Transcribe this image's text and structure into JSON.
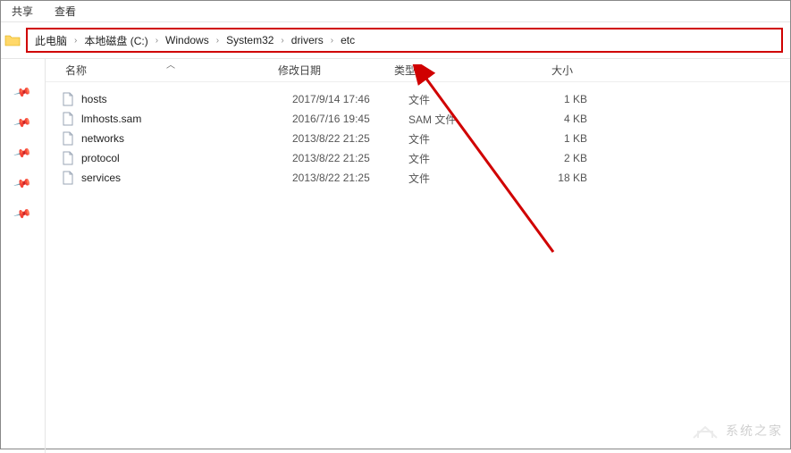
{
  "menubar": {
    "share": "共享",
    "view": "查看"
  },
  "breadcrumb": [
    "此电脑",
    "本地磁盘 (C:)",
    "Windows",
    "System32",
    "drivers",
    "etc"
  ],
  "columns": {
    "name": "名称",
    "date": "修改日期",
    "type": "类型",
    "size": "大小"
  },
  "files": [
    {
      "name": "hosts",
      "date": "2017/9/14 17:46",
      "type": "文件",
      "size": "1 KB"
    },
    {
      "name": "lmhosts.sam",
      "date": "2016/7/16 19:45",
      "type": "SAM 文件",
      "size": "4 KB"
    },
    {
      "name": "networks",
      "date": "2013/8/22 21:25",
      "type": "文件",
      "size": "1 KB"
    },
    {
      "name": "protocol",
      "date": "2013/8/22 21:25",
      "type": "文件",
      "size": "2 KB"
    },
    {
      "name": "services",
      "date": "2013/8/22 21:25",
      "type": "文件",
      "size": "18 KB"
    }
  ],
  "watermark": "系统之家"
}
